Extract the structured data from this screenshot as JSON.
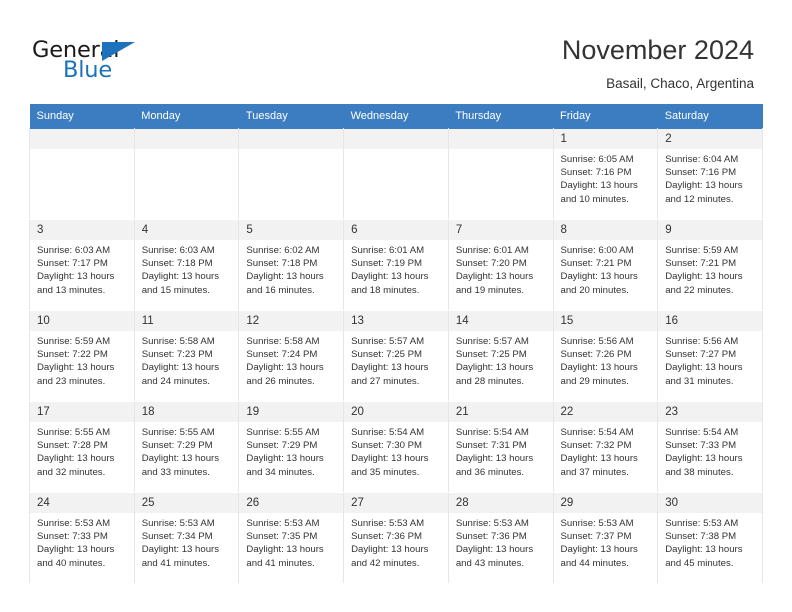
{
  "brand": {
    "name_part1": "General",
    "name_part2": "Blue"
  },
  "header": {
    "title": "November 2024",
    "subtitle": "Basail, Chaco, Argentina"
  },
  "colors": {
    "header_blue": "#3b7dc0",
    "brand_blue": "#1c72bb",
    "daynum_band": "#f2f2f2",
    "text": "#333333"
  },
  "weekdays": [
    "Sunday",
    "Monday",
    "Tuesday",
    "Wednesday",
    "Thursday",
    "Friday",
    "Saturday"
  ],
  "weeks": [
    [
      {
        "day": "",
        "empty": true
      },
      {
        "day": "",
        "empty": true
      },
      {
        "day": "",
        "empty": true
      },
      {
        "day": "",
        "empty": true
      },
      {
        "day": "",
        "empty": true
      },
      {
        "day": "1",
        "sunrise": "Sunrise: 6:05 AM",
        "sunset": "Sunset: 7:16 PM",
        "daylight": "Daylight: 13 hours and 10 minutes."
      },
      {
        "day": "2",
        "sunrise": "Sunrise: 6:04 AM",
        "sunset": "Sunset: 7:16 PM",
        "daylight": "Daylight: 13 hours and 12 minutes."
      }
    ],
    [
      {
        "day": "3",
        "sunrise": "Sunrise: 6:03 AM",
        "sunset": "Sunset: 7:17 PM",
        "daylight": "Daylight: 13 hours and 13 minutes."
      },
      {
        "day": "4",
        "sunrise": "Sunrise: 6:03 AM",
        "sunset": "Sunset: 7:18 PM",
        "daylight": "Daylight: 13 hours and 15 minutes."
      },
      {
        "day": "5",
        "sunrise": "Sunrise: 6:02 AM",
        "sunset": "Sunset: 7:18 PM",
        "daylight": "Daylight: 13 hours and 16 minutes."
      },
      {
        "day": "6",
        "sunrise": "Sunrise: 6:01 AM",
        "sunset": "Sunset: 7:19 PM",
        "daylight": "Daylight: 13 hours and 18 minutes."
      },
      {
        "day": "7",
        "sunrise": "Sunrise: 6:01 AM",
        "sunset": "Sunset: 7:20 PM",
        "daylight": "Daylight: 13 hours and 19 minutes."
      },
      {
        "day": "8",
        "sunrise": "Sunrise: 6:00 AM",
        "sunset": "Sunset: 7:21 PM",
        "daylight": "Daylight: 13 hours and 20 minutes."
      },
      {
        "day": "9",
        "sunrise": "Sunrise: 5:59 AM",
        "sunset": "Sunset: 7:21 PM",
        "daylight": "Daylight: 13 hours and 22 minutes."
      }
    ],
    [
      {
        "day": "10",
        "sunrise": "Sunrise: 5:59 AM",
        "sunset": "Sunset: 7:22 PM",
        "daylight": "Daylight: 13 hours and 23 minutes."
      },
      {
        "day": "11",
        "sunrise": "Sunrise: 5:58 AM",
        "sunset": "Sunset: 7:23 PM",
        "daylight": "Daylight: 13 hours and 24 minutes."
      },
      {
        "day": "12",
        "sunrise": "Sunrise: 5:58 AM",
        "sunset": "Sunset: 7:24 PM",
        "daylight": "Daylight: 13 hours and 26 minutes."
      },
      {
        "day": "13",
        "sunrise": "Sunrise: 5:57 AM",
        "sunset": "Sunset: 7:25 PM",
        "daylight": "Daylight: 13 hours and 27 minutes."
      },
      {
        "day": "14",
        "sunrise": "Sunrise: 5:57 AM",
        "sunset": "Sunset: 7:25 PM",
        "daylight": "Daylight: 13 hours and 28 minutes."
      },
      {
        "day": "15",
        "sunrise": "Sunrise: 5:56 AM",
        "sunset": "Sunset: 7:26 PM",
        "daylight": "Daylight: 13 hours and 29 minutes."
      },
      {
        "day": "16",
        "sunrise": "Sunrise: 5:56 AM",
        "sunset": "Sunset: 7:27 PM",
        "daylight": "Daylight: 13 hours and 31 minutes."
      }
    ],
    [
      {
        "day": "17",
        "sunrise": "Sunrise: 5:55 AM",
        "sunset": "Sunset: 7:28 PM",
        "daylight": "Daylight: 13 hours and 32 minutes."
      },
      {
        "day": "18",
        "sunrise": "Sunrise: 5:55 AM",
        "sunset": "Sunset: 7:29 PM",
        "daylight": "Daylight: 13 hours and 33 minutes."
      },
      {
        "day": "19",
        "sunrise": "Sunrise: 5:55 AM",
        "sunset": "Sunset: 7:29 PM",
        "daylight": "Daylight: 13 hours and 34 minutes."
      },
      {
        "day": "20",
        "sunrise": "Sunrise: 5:54 AM",
        "sunset": "Sunset: 7:30 PM",
        "daylight": "Daylight: 13 hours and 35 minutes."
      },
      {
        "day": "21",
        "sunrise": "Sunrise: 5:54 AM",
        "sunset": "Sunset: 7:31 PM",
        "daylight": "Daylight: 13 hours and 36 minutes."
      },
      {
        "day": "22",
        "sunrise": "Sunrise: 5:54 AM",
        "sunset": "Sunset: 7:32 PM",
        "daylight": "Daylight: 13 hours and 37 minutes."
      },
      {
        "day": "23",
        "sunrise": "Sunrise: 5:54 AM",
        "sunset": "Sunset: 7:33 PM",
        "daylight": "Daylight: 13 hours and 38 minutes."
      }
    ],
    [
      {
        "day": "24",
        "sunrise": "Sunrise: 5:53 AM",
        "sunset": "Sunset: 7:33 PM",
        "daylight": "Daylight: 13 hours and 40 minutes."
      },
      {
        "day": "25",
        "sunrise": "Sunrise: 5:53 AM",
        "sunset": "Sunset: 7:34 PM",
        "daylight": "Daylight: 13 hours and 41 minutes."
      },
      {
        "day": "26",
        "sunrise": "Sunrise: 5:53 AM",
        "sunset": "Sunset: 7:35 PM",
        "daylight": "Daylight: 13 hours and 41 minutes."
      },
      {
        "day": "27",
        "sunrise": "Sunrise: 5:53 AM",
        "sunset": "Sunset: 7:36 PM",
        "daylight": "Daylight: 13 hours and 42 minutes."
      },
      {
        "day": "28",
        "sunrise": "Sunrise: 5:53 AM",
        "sunset": "Sunset: 7:36 PM",
        "daylight": "Daylight: 13 hours and 43 minutes."
      },
      {
        "day": "29",
        "sunrise": "Sunrise: 5:53 AM",
        "sunset": "Sunset: 7:37 PM",
        "daylight": "Daylight: 13 hours and 44 minutes."
      },
      {
        "day": "30",
        "sunrise": "Sunrise: 5:53 AM",
        "sunset": "Sunset: 7:38 PM",
        "daylight": "Daylight: 13 hours and 45 minutes."
      }
    ]
  ]
}
